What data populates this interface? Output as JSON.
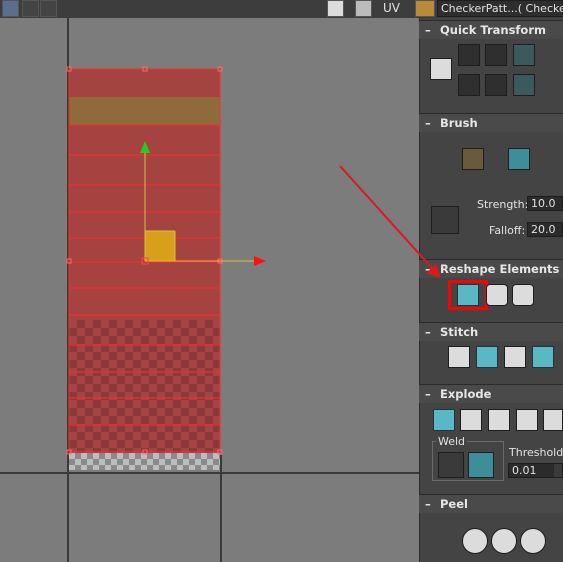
{
  "toolbar": {
    "uv_label": "UV",
    "material_name": "CheckerPatt...( Checker )"
  },
  "panel": {
    "quick_transform": {
      "title": "Quick Transform"
    },
    "brush": {
      "title": "Brush",
      "strength_label": "Strength:",
      "strength_value": "10.0",
      "falloff_label": "Falloff:",
      "falloff_value": "20.0"
    },
    "reshape": {
      "title": "Reshape Elements"
    },
    "stitch": {
      "title": "Stitch"
    },
    "explode": {
      "title": "Explode",
      "weld_label": "Weld",
      "threshold_label": "Threshold:",
      "threshold_value": "0.01"
    },
    "peel": {
      "title": "Peel"
    }
  },
  "colors": {
    "selection_fill": "#a33a3a",
    "selection_edge": "#ff2a2a",
    "gizmo_y": "#22cc22",
    "gizmo_x": "#ff1010",
    "gizmo_center": "#d8a018",
    "highlight_box": "#ff0000",
    "annotation_arrow": "#d91a1a",
    "teal": "#5ab7c4"
  }
}
